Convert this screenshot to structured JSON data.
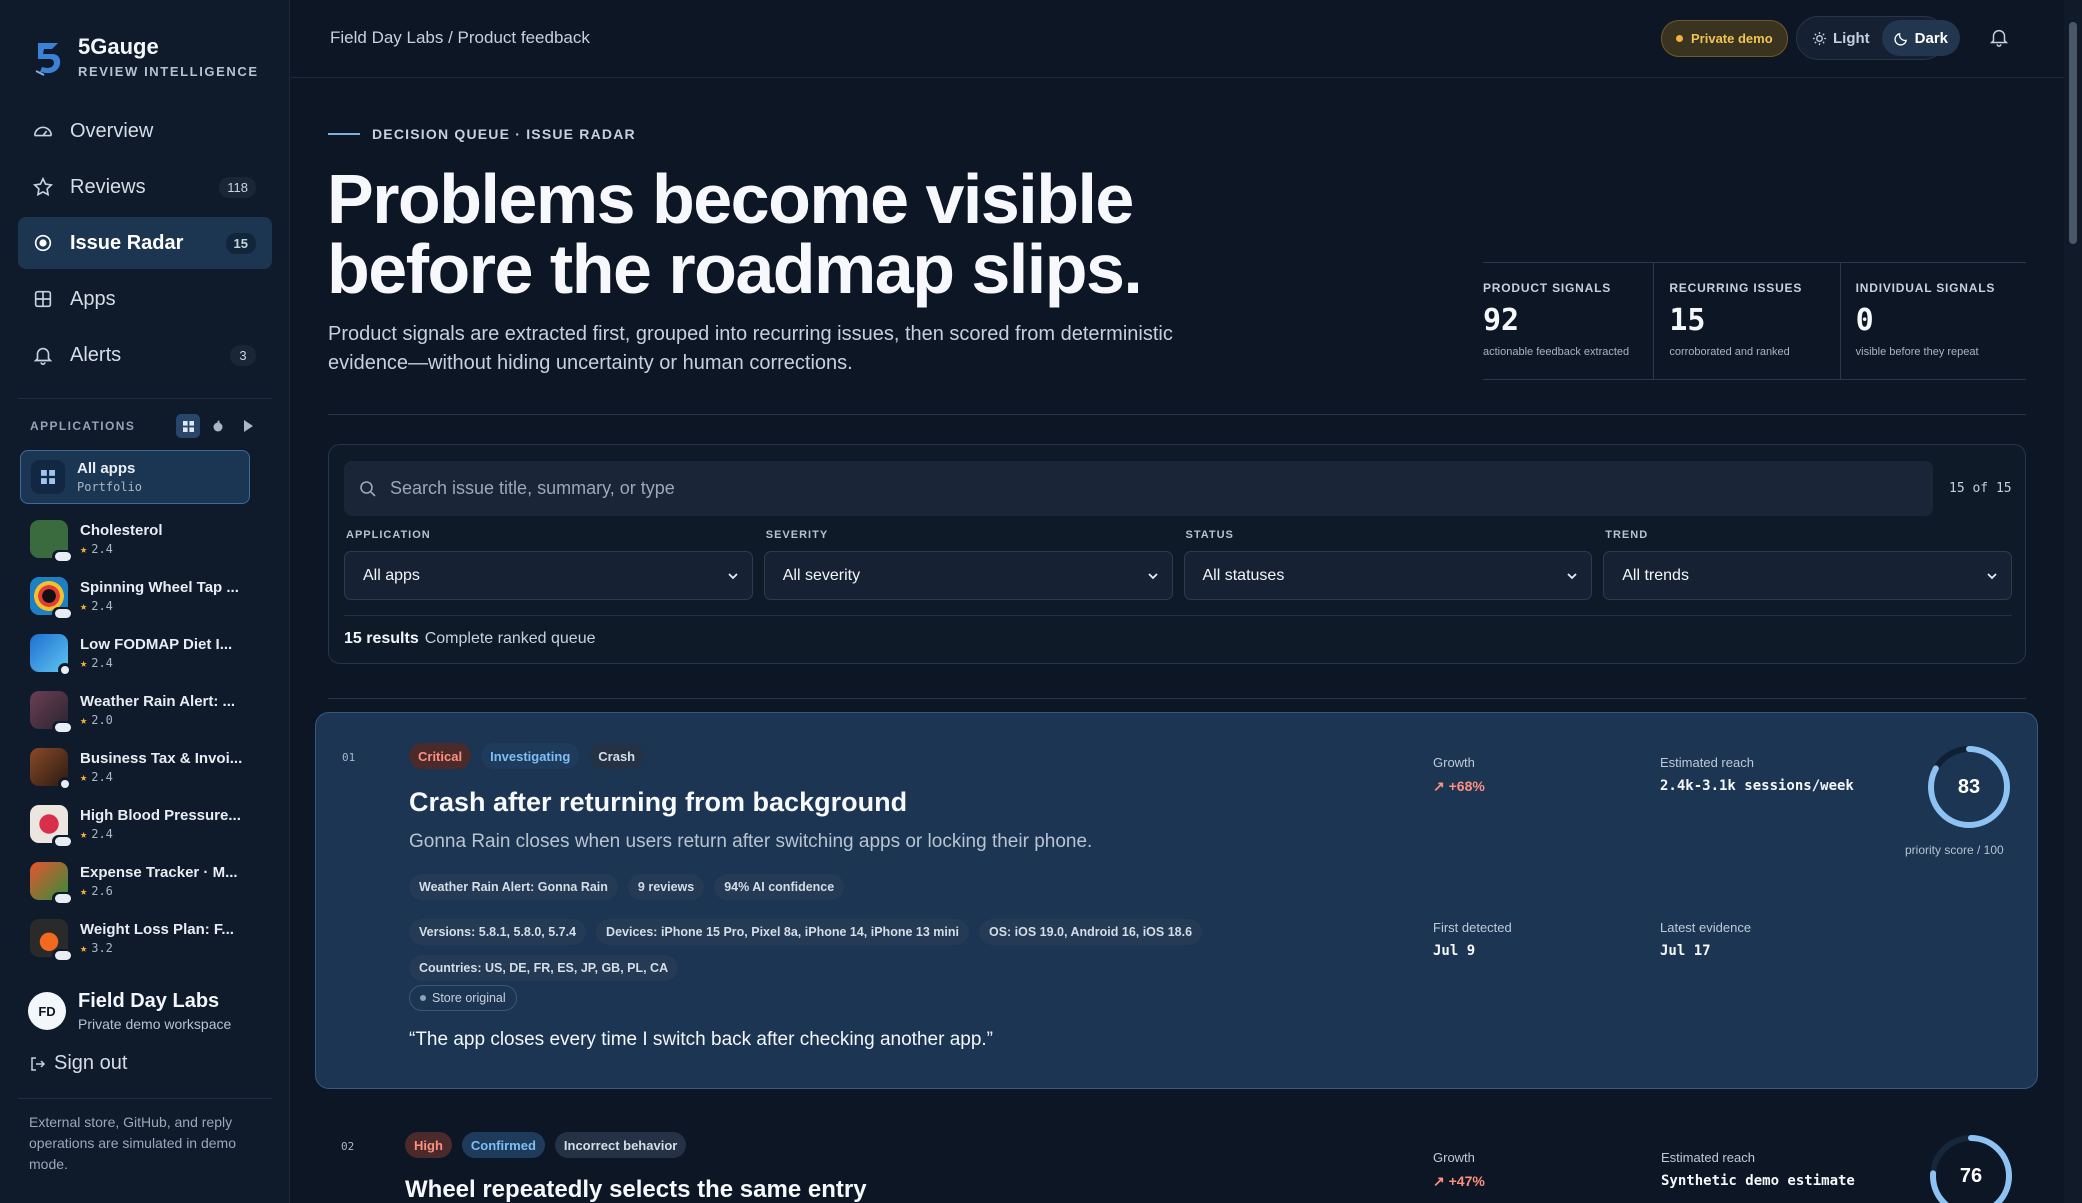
{
  "brand": {
    "name": "5Gauge",
    "subtitle": "REVIEW INTELLIGENCE"
  },
  "nav": [
    {
      "label": "Overview",
      "icon": "gauge-icon",
      "count": ""
    },
    {
      "label": "Reviews",
      "icon": "star-icon",
      "count": "118"
    },
    {
      "label": "Issue Radar",
      "icon": "radar-icon",
      "count": "15"
    },
    {
      "label": "Apps",
      "icon": "grid-icon",
      "count": ""
    },
    {
      "label": "Alerts",
      "icon": "bell-icon",
      "count": "3"
    }
  ],
  "applications": {
    "heading": "APPLICATIONS",
    "all": {
      "name": "All apps",
      "sub": "Portfolio"
    },
    "items": [
      {
        "name": "Cholesterol",
        "rating": "2.4",
        "color": "#3a6b3f"
      },
      {
        "name": "Spinning Wheel Tap ...",
        "rating": "2.4",
        "color": "#1d7fc4"
      },
      {
        "name": "Low FODMAP Diet I...",
        "rating": "2.4",
        "color": "#1f6fd1"
      },
      {
        "name": "Weather Rain Alert: ...",
        "rating": "2.0",
        "color": "#5a3a4a"
      },
      {
        "name": "Business Tax & Invoi...",
        "rating": "2.4",
        "color": "#6b3a22"
      },
      {
        "name": "High Blood Pressure...",
        "rating": "2.4",
        "color": "#e8e3dd"
      },
      {
        "name": "Expense Tracker · M...",
        "rating": "2.6",
        "color": "#d9452b"
      },
      {
        "name": "Weight Loss Plan: F...",
        "rating": "3.2",
        "color": "#2a2a2a"
      }
    ]
  },
  "workspace": {
    "initials": "FD",
    "name": "Field Day Labs",
    "sub": "Private demo workspace"
  },
  "signout": "Sign out",
  "side_note": "External store, GitHub, and reply operations are simulated in demo mode.",
  "topbar": {
    "breadcrumb": "Field Day Labs / Product feedback",
    "demo": "Private demo",
    "light": "Light",
    "dark": "Dark"
  },
  "hero": {
    "eyebrow": "DECISION QUEUE · ISSUE RADAR",
    "title": "Problems become visible before the roadmap slips.",
    "subtitle": "Product signals are extracted first, grouped into recurring issues, then scored from deterministic evidence—without hiding uncertainty or human corrections."
  },
  "stats": [
    {
      "label": "PRODUCT SIGNALS",
      "value": "92",
      "sub": "actionable feedback extracted"
    },
    {
      "label": "RECURRING ISSUES",
      "value": "15",
      "sub": "corroborated and ranked"
    },
    {
      "label": "INDIVIDUAL SIGNALS",
      "value": "0",
      "sub": "visible before they repeat"
    }
  ],
  "filters": {
    "search_placeholder": "Search issue title, summary, or type",
    "count": "15 of 15",
    "fields": [
      {
        "label": "APPLICATION",
        "value": "All apps"
      },
      {
        "label": "SEVERITY",
        "value": "All severity"
      },
      {
        "label": "STATUS",
        "value": "All statuses"
      },
      {
        "label": "TREND",
        "value": "All trends"
      }
    ],
    "results_count": "15 results",
    "results_note": "Complete ranked queue"
  },
  "issues": [
    {
      "rank": "01",
      "severity": "Critical",
      "status": "Investigating",
      "type": "Crash",
      "title": "Crash after returning from background",
      "summary": "Gonna Rain closes when users return after switching apps or locking their phone.",
      "app": "Weather Rain Alert: Gonna Rain",
      "reviews": "9 reviews",
      "confidence": "94% AI confidence",
      "versions": "Versions: 5.8.1, 5.8.0, 5.7.4",
      "devices": "Devices: iPhone 15 Pro, Pixel 8a, iPhone 14, iPhone 13 mini",
      "os": "OS: iOS 19.0, Android 16, iOS 18.6",
      "countries": "Countries: US, DE, FR, ES, JP, GB, PL, CA",
      "store_original": "Store original",
      "quote": "“The app closes every time I switch back after checking another app.”",
      "growth_label": "Growth",
      "growth": "+68%",
      "reach_label": "Estimated reach",
      "reach": "2.4k-3.1k sessions/week",
      "first_label": "First detected",
      "first": "Jul 9",
      "latest_label": "Latest evidence",
      "latest": "Jul 17",
      "score": 83,
      "score_caption": "priority score / 100"
    },
    {
      "rank": "02",
      "severity": "High",
      "status": "Confirmed",
      "type": "Incorrect behavior",
      "title": "Wheel repeatedly selects the same entry",
      "growth_label": "Growth",
      "growth": "+47%",
      "reach_label": "Estimated reach",
      "reach": "Synthetic demo estimate",
      "score": 76
    }
  ]
}
